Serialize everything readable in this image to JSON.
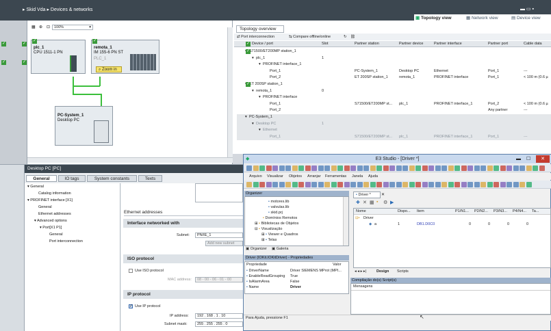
{
  "tia": {
    "breadcrumb": [
      "Skid Vda",
      "Devices & networks"
    ],
    "zoom": "100%",
    "views": [
      "Topology view",
      "Network view",
      "Device view"
    ]
  },
  "network": {
    "plc": {
      "name": "plc_1",
      "type": "CPU 1511-1 PN"
    },
    "remote": {
      "name": "remota_1",
      "type": "IM 155-6 PN ST",
      "link": "PLC_1"
    },
    "zoom_in": "Zoom in",
    "pc": {
      "name": "PC-System_1",
      "type": "Desktop PC"
    }
  },
  "topology": {
    "title": "Topology overview",
    "toolbar": [
      "Port interconnection",
      "Compare offline/online"
    ],
    "columns": [
      "Device / port",
      "Slot",
      "Partner station",
      "Partner device",
      "Partner interface",
      "Partner port",
      "Cable data"
    ],
    "rows": [
      {
        "device": "S71500/ET200MP station_1",
        "slot": "",
        "pstation": "",
        "pdevice": "",
        "pinterface": "",
        "pport": "",
        "cable": "",
        "indent": 1
      },
      {
        "device": "plc_1",
        "slot": "1",
        "pstation": "",
        "pdevice": "",
        "pinterface": "",
        "pport": "",
        "cable": "",
        "indent": 2
      },
      {
        "device": "PROFINET interface_1",
        "slot": "",
        "pstation": "",
        "pdevice": "",
        "pinterface": "",
        "pport": "",
        "cable": "",
        "indent": 3
      },
      {
        "device": "Port_1",
        "slot": "",
        "pstation": "PC-System_1",
        "pdevice": "Desktop PC",
        "pinterface": "Ethernet",
        "pport": "Port_1",
        "cable": "---",
        "indent": 4
      },
      {
        "device": "Port_2",
        "slot": "",
        "pstation": "ET 200SP station_1",
        "pdevice": "remota_1",
        "pinterface": "PROFINET interface",
        "pport": "Port_1",
        "cable": "< 100 m (0.6 µ",
        "indent": 4
      },
      {
        "device": "ET 200SP station_1",
        "slot": "",
        "pstation": "",
        "pdevice": "",
        "pinterface": "",
        "pport": "",
        "cable": "",
        "indent": 1
      },
      {
        "device": "remota_1",
        "slot": "0",
        "pstation": "",
        "pdevice": "",
        "pinterface": "",
        "pport": "",
        "cable": "",
        "indent": 2
      },
      {
        "device": "PROFINET interface",
        "slot": "",
        "pstation": "",
        "pdevice": "",
        "pinterface": "",
        "pport": "",
        "cable": "",
        "indent": 3
      },
      {
        "device": "Port_1",
        "slot": "",
        "pstation": "S71500/ET200MP st...",
        "pdevice": "plc_1",
        "pinterface": "PROFINET interface_1",
        "pport": "Port_2",
        "cable": "< 100 m (0.6 µ",
        "indent": 4
      },
      {
        "device": "Port_2",
        "slot": "",
        "pstation": "",
        "pdevice": "",
        "pinterface": "",
        "pport": "Any partner",
        "cable": "---",
        "indent": 4
      },
      {
        "device": "PC-System_1",
        "slot": "",
        "pstation": "",
        "pdevice": "",
        "pinterface": "",
        "pport": "",
        "cable": "",
        "indent": 1
      },
      {
        "device": "Desktop PC",
        "slot": "1",
        "pstation": "",
        "pdevice": "",
        "pinterface": "",
        "pport": "",
        "cable": "",
        "indent": 2
      },
      {
        "device": "Ethernet",
        "slot": "",
        "pstation": "",
        "pdevice": "",
        "pinterface": "",
        "pport": "",
        "cable": "",
        "indent": 3
      },
      {
        "device": "Port_1",
        "slot": "",
        "pstation": "S71500/ET200MP st...",
        "pdevice": "plc_1",
        "pinterface": "PROFINET interface_1",
        "pport": "Port_1",
        "cable": "---",
        "indent": 4
      }
    ]
  },
  "inspector": {
    "title": "Desktop PC [PC]",
    "tabs": [
      "General",
      "IO tags",
      "System constants",
      "Texts"
    ],
    "tree": [
      "General",
      "Catalog information",
      "PROFINET interface [X1]",
      "General",
      "Ethernet addresses",
      "Advanced options",
      "Port[X1 P1]",
      "General",
      "Port interconnection"
    ],
    "section_eth": "Ethernet addresses",
    "iface_networked": "Interface networked with",
    "subnet_label": "Subnet:",
    "subnet_value": "PN/IE_1",
    "add_subnet": "Add new subnet",
    "iso_title": "ISO protocol",
    "use_iso": "Use ISO protocol",
    "mac_label": "MAC address:",
    "mac_value": "08 - 00 - 06 - 01 - 00",
    "ip_title": "IP protocol",
    "use_ip": "Use IP protocol",
    "ip_label": "IP address:",
    "ip_value": [
      "192",
      "168",
      "1",
      "10"
    ],
    "mask_label": "Subnet mask:",
    "mask_value": [
      "255",
      "255",
      "255",
      "0"
    ]
  },
  "e3": {
    "title": "E3 Studio - [Driver *]",
    "menu": [
      "Arquivo",
      "Visualizar",
      "Objetos",
      "Arranjar",
      "Ferramentas",
      "Janela",
      "Ajuda"
    ],
    "organizer": {
      "title": "Organizer",
      "items": [
        "motores.lib",
        "valvulas.lib",
        "skid.prj",
        "Domínios Remotos",
        "Bibliotecas de Objetos",
        "Visualização",
        "Viewer e Quadros",
        "Telas"
      ],
      "tabs": [
        "Organizer",
        "Galeria"
      ]
    },
    "props": {
      "title": "Driver (IOKit.IOKitDriver) - Propriedades",
      "col_prop": "Propriedade",
      "col_val": "Valor",
      "rows": [
        {
          "name": "DriverName",
          "value": "Driver SIEMENS MProt (MPI..."
        },
        {
          "name": "EnableReadGrouping",
          "value": "True"
        },
        {
          "name": "IsAlarmArea",
          "value": "False"
        },
        {
          "name": "Name",
          "value": "Driver"
        }
      ]
    },
    "driver": {
      "tab": "Driver *",
      "columns": [
        "Nome",
        "Dispo...",
        "Item",
        "P1/N1...",
        "P2/N2...",
        "P3/N3...",
        "P4/N4...",
        "Ta..."
      ],
      "rows": [
        {
          "name": "Driver",
          "dispo": "",
          "item": "",
          "p1": "",
          "p2": "",
          "p3": "",
          "p4": ""
        },
        {
          "name": "a",
          "dispo": "1",
          "item": "DB1.D0C0",
          "p1": "0",
          "p2": "0",
          "p3": "0",
          "p4": "0"
        }
      ],
      "bottom_tabs": [
        "Design",
        "Scripts"
      ]
    },
    "messages": {
      "title": "Compilação do(s) Script(s)",
      "col": "Mensagens"
    },
    "status": "Para Ajuda, pressione F1"
  }
}
